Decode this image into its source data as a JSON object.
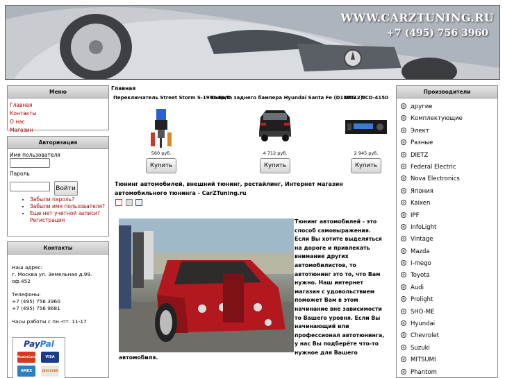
{
  "header": {
    "site_url": "WWW.CARZTUNING.RU",
    "phone": "+7 (495) 756 3960"
  },
  "breadcrumb": "Главная",
  "menu": {
    "title": "Меню",
    "items": [
      "Главная",
      "Контакты",
      "О нас",
      "Магазин"
    ]
  },
  "auth": {
    "title": "Авторизация",
    "username_label": "Имя пользователя",
    "username_value": "",
    "password_label": "Пароль",
    "password_value": "",
    "login_label": "Войти",
    "links": [
      "Забыли пароль?",
      "Забыли имя пользователя?",
      "Еще нет учетной записи? Регистрация"
    ]
  },
  "contacts": {
    "title": "Контакты",
    "address_label": "Наш адрес:",
    "address": "г. Москва ул. Земельная д.99. оф.452",
    "phones_label": "Телефоны:",
    "phone1": "+7 (495) 756 3960",
    "phone2": "+7 (495) 756 9681",
    "hours": "Часы работы с пн.-пт. 11-17",
    "paypal": {
      "pay": "Pay",
      "pal": "Pal",
      "cards": [
        "MasterCard",
        "VISA",
        "AMEX",
        "DISCOVER"
      ]
    }
  },
  "products": [
    {
      "name": "Переключатель Street Storm S-1991-BL/T",
      "price": "560 руб.",
      "button": "Купить"
    },
    {
      "name": "Защита заднего бампера Hyundai Santa Fe (D130312)\"",
      "price": "4 712 руб.",
      "button": "Купить"
    },
    {
      "name": "NRG - NCD-4150",
      "price": "2 945 руб.",
      "button": "Купить"
    }
  ],
  "article": {
    "title": "Тюнинг автомобилей, внешний тюнинг, рестайлинг, Интернет магазин автомобильного тюнинга - CarZTuning.ru",
    "icons": [
      "pdf-icon",
      "print-icon",
      "email-icon"
    ],
    "text": "Тюнинг автомобилей - это способ самовыражения. Если Вы хотите выделяться на дороге и привлекать внимание других автомобилистов, то автотюнинг это то, что Вам нужно. Наш интернет магазин с удовольствием поможет Вам в этом начинание вне зависимости то Вашего уровня. Если Вы начинающий или профессионал автотюнинга, у нас Вы подберёте что-то нужное для Вашего",
    "text_tail": "автомобиля."
  },
  "manufacturers": {
    "title": "Производители",
    "items": [
      "другие",
      "Комплектующие",
      "Элект",
      "Разные",
      "DIETZ",
      "Federal Electric",
      "Nova Electronics",
      "Япония",
      "Kaixen",
      "IPF",
      "InfoLight",
      "Vintage",
      "Mazda",
      "I-mego",
      "Toyota",
      "Audi",
      "Prolight",
      "SHO-ME",
      "Hyundai",
      "Chevrolet",
      "Suzuki",
      "MITSUMI",
      "Phantom"
    ]
  },
  "colors": {
    "link": "#a40000",
    "box_header": "#d0d0d0"
  }
}
